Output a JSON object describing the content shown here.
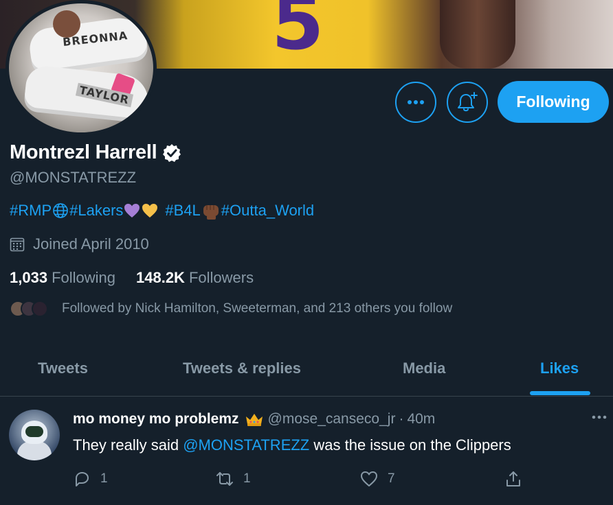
{
  "profile": {
    "display_name": "Montrezl Harrell",
    "handle": "@MONSTATREZZ",
    "verified": true,
    "banner_jersey_number": "5",
    "avatar_text_top": "BREONNA",
    "avatar_text_bottom": "TAYLOR",
    "bio": {
      "tags": [
        "#RMP",
        "#Lakers",
        "#B4L",
        "#Outta_World"
      ],
      "emojis": [
        "globe-icon",
        "purple-heart",
        "yellow-heart",
        "raised-fist"
      ]
    },
    "joined": "Joined April 2010",
    "following_count": "1,033",
    "following_label": "Following",
    "followers_count": "148.2K",
    "followers_label": "Followers",
    "followed_by": "Followed by Nick Hamilton, Sweeterman, and 213 others you follow"
  },
  "actions": {
    "more_icon": "more-icon",
    "notify_icon": "bell-plus-icon",
    "follow_label": "Following"
  },
  "tabs": [
    {
      "label": "Tweets",
      "active": false
    },
    {
      "label": "Tweets & replies",
      "active": false
    },
    {
      "label": "Media",
      "active": false
    },
    {
      "label": "Likes",
      "active": true
    }
  ],
  "tweet": {
    "author_name": "mo money mo problemz",
    "author_emoji": "crown",
    "author_handle": "@mose_canseco_jr",
    "separator": "·",
    "time": "40m",
    "text_before": "They really said ",
    "mention": "@MONSTATREZZ",
    "text_after": " was the issue on the Clippers",
    "reply_count": "1",
    "retweet_count": "1",
    "like_count": "7"
  },
  "colors": {
    "background": "#15202b",
    "accent": "#1da1f2",
    "muted_text": "#8899a6",
    "divider": "#38444d"
  }
}
